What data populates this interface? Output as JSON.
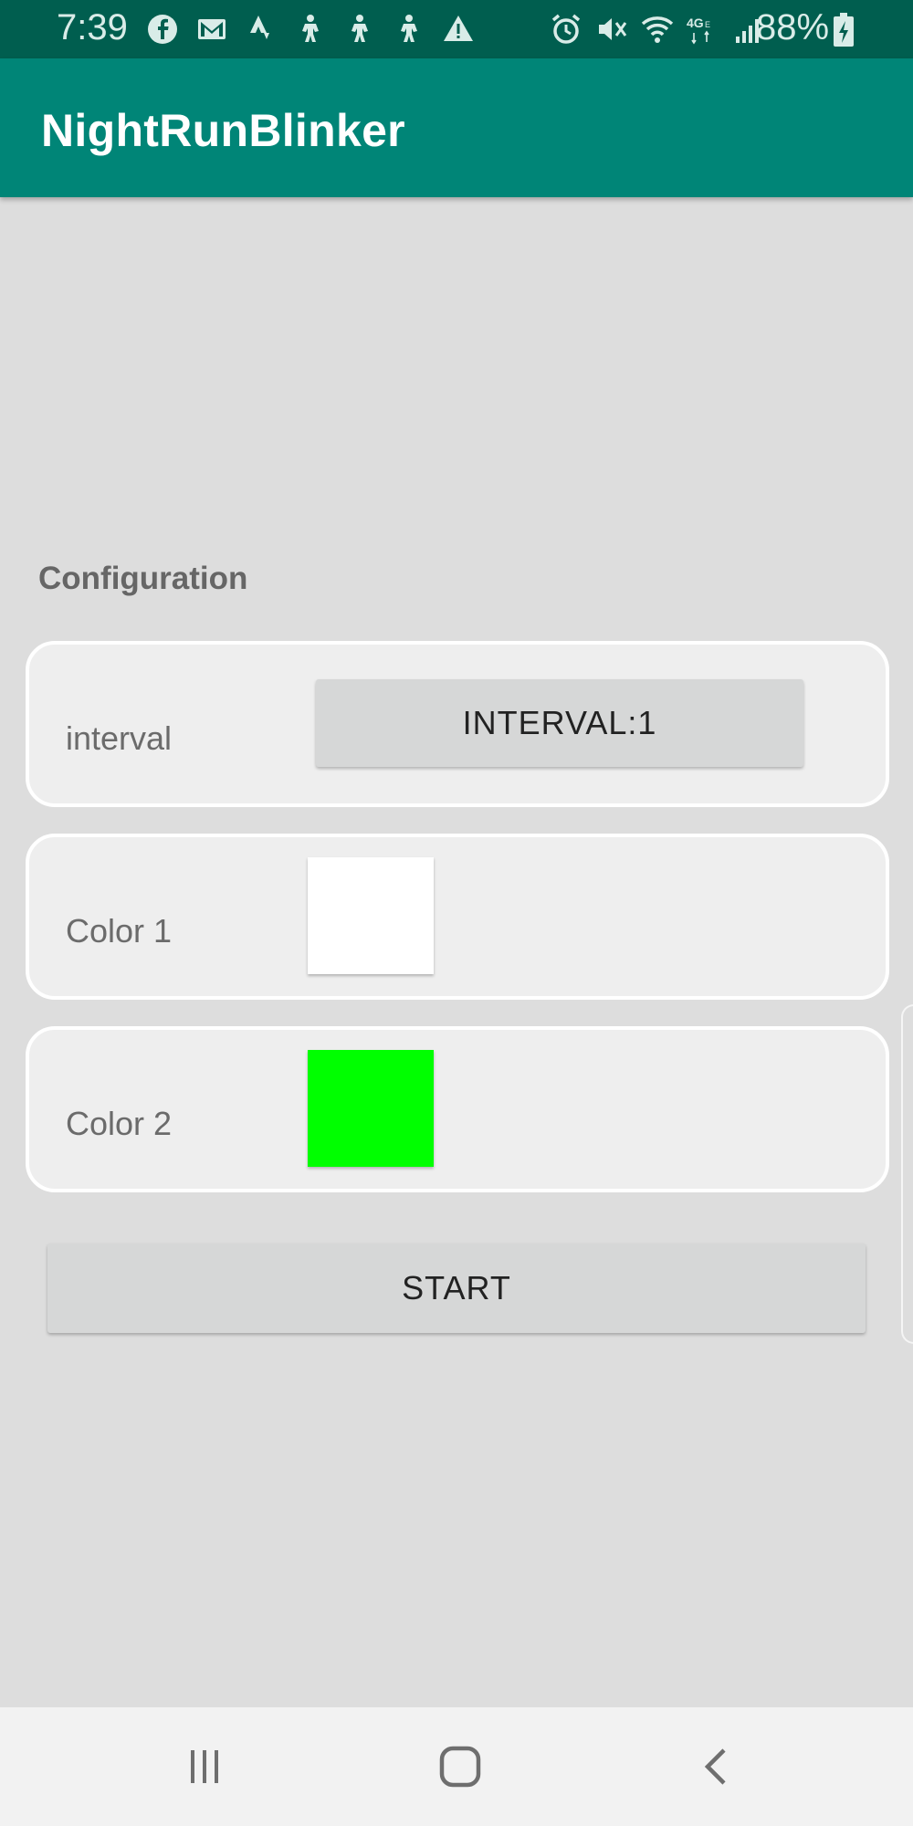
{
  "status_bar": {
    "time": "7:39",
    "battery": "88%",
    "left_icons": [
      "facebook-icon",
      "gmail-icon",
      "strava-icon",
      "figure-icon",
      "figure-icon",
      "figure-icon",
      "warning-icon"
    ],
    "right_icons": [
      "alarm-icon",
      "mute-icon",
      "wifi-icon",
      "lte-icon",
      "signal-icon",
      "battery-charging-icon"
    ]
  },
  "app_bar": {
    "title": "NightRunBlinker"
  },
  "config": {
    "section_title": "Configuration",
    "interval": {
      "label": "interval",
      "button_label": "INTERVAL:1"
    },
    "color1": {
      "label": "Color 1",
      "color": "#ffffff"
    },
    "color2": {
      "label": "Color 2",
      "color": "#00ff00"
    }
  },
  "start_button": {
    "label": "START"
  },
  "nav_bar": {
    "icons": [
      "recents-icon",
      "home-icon",
      "back-icon"
    ]
  },
  "colors": {
    "status_bar": "#005e4f",
    "app_bar": "#008577",
    "background": "#dddddd"
  }
}
